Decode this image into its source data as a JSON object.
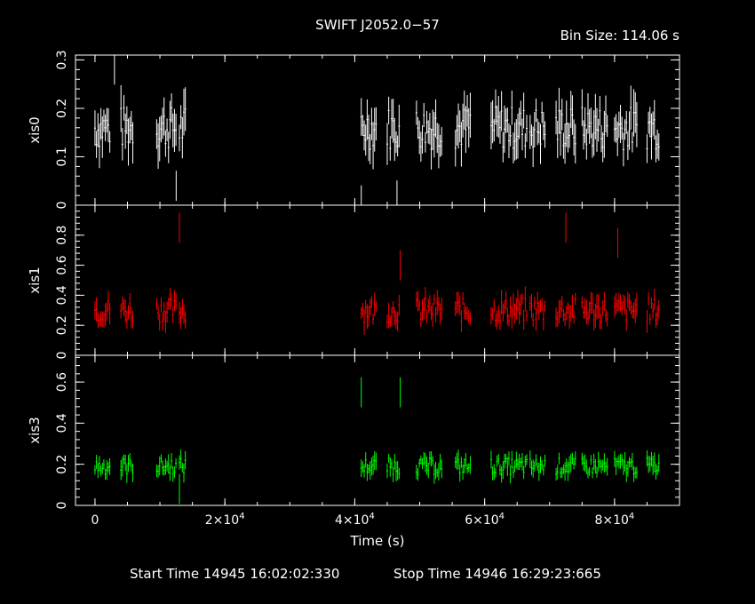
{
  "chart_data": {
    "type": "scatter",
    "title": "SWIFT J2052.0−57",
    "bin_size_label": "Bin Size: 114.06 s",
    "xlabel": "Time (s)",
    "xlim": [
      -3000,
      90000
    ],
    "x_ticks": [
      {
        "value": 0,
        "mant": "0",
        "exp": ""
      },
      {
        "value": 20000,
        "mant": "2×10",
        "exp": "4"
      },
      {
        "value": 40000,
        "mant": "4×10",
        "exp": "4"
      },
      {
        "value": 60000,
        "mant": "6×10",
        "exp": "4"
      },
      {
        "value": 80000,
        "mant": "8×10",
        "exp": "4"
      }
    ],
    "start_time_label": "Start Time 14945 16:02:02:330",
    "stop_time_label": "Stop Time 14946 16:29:23:665",
    "segments": [
      [
        0,
        2500
      ],
      [
        4000,
        6000
      ],
      [
        9500,
        12500
      ],
      [
        13000,
        14000
      ],
      [
        41000,
        43500
      ],
      [
        45000,
        47000
      ],
      [
        49500,
        53500
      ],
      [
        55500,
        58000
      ],
      [
        61000,
        66500
      ],
      [
        67000,
        69500
      ],
      [
        71000,
        74000
      ],
      [
        75000,
        79000
      ],
      [
        80000,
        83500
      ],
      [
        85000,
        87000
      ]
    ],
    "panels": [
      {
        "name": "xis0",
        "color": "#ffffff",
        "ylim": [
          0,
          0.31
        ],
        "yticks": [
          0,
          0.1,
          0.2,
          0.3
        ],
        "yticklabels": [
          "0",
          "0.1",
          "0.2",
          "0.3"
        ],
        "mean": 0.16,
        "spread": 0.045,
        "err": 0.035,
        "spikes": [
          {
            "x": 3000,
            "y": 0.28
          },
          {
            "x": 12500,
            "y": 0.04
          },
          {
            "x": 41000,
            "y": 0.01
          },
          {
            "x": 46500,
            "y": 0.02
          }
        ]
      },
      {
        "name": "xis1",
        "color": "#ff0000",
        "ylim": [
          0,
          1.0
        ],
        "yticks": [
          0,
          0.2,
          0.4,
          0.6,
          0.8
        ],
        "yticklabels": [
          "0",
          "0.2",
          "0.4",
          "0.6",
          "0.8"
        ],
        "mean": 0.3,
        "spread": 0.08,
        "err": 0.06,
        "spikes": [
          {
            "x": 13000,
            "y": 0.85
          },
          {
            "x": 47000,
            "y": 0.6
          },
          {
            "x": 72500,
            "y": 0.85
          },
          {
            "x": 80500,
            "y": 0.75
          }
        ]
      },
      {
        "name": "xis3",
        "color": "#00ff00",
        "ylim": [
          0,
          0.73
        ],
        "yticks": [
          0,
          0.2,
          0.4,
          0.6
        ],
        "yticklabels": [
          "0",
          "0.2",
          "0.4",
          "0.6"
        ],
        "mean": 0.19,
        "spread": 0.04,
        "err": 0.035,
        "spikes": [
          {
            "x": 41000,
            "y": 0.55
          },
          {
            "x": 47000,
            "y": 0.55
          },
          {
            "x": 13000,
            "y": 0.08
          }
        ]
      }
    ]
  }
}
